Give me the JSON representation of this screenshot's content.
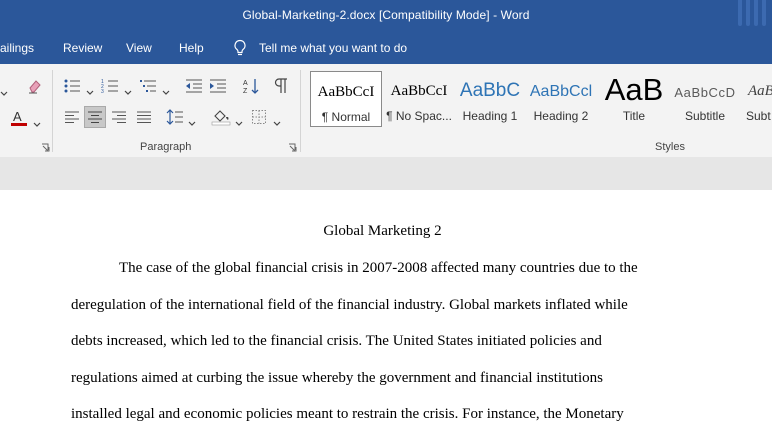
{
  "window": {
    "title": "Global-Marketing-2.docx [Compatibility Mode]  -  Word"
  },
  "tabs": [
    {
      "label": "ailings"
    },
    {
      "label": "Review"
    },
    {
      "label": "View"
    },
    {
      "label": "Help"
    }
  ],
  "tell_me": {
    "label": "Tell me what you want to do",
    "icon": "lightbulb-icon"
  },
  "ribbon": {
    "paragraph_group": {
      "label": "Paragraph"
    },
    "styles_group": {
      "label": "Styles"
    },
    "styles": [
      {
        "sample": "AaBbCcI",
        "name": "¶ Normal",
        "selected": true
      },
      {
        "sample": "AaBbCcI",
        "name": "¶ No Spac..."
      },
      {
        "sample": "AaBbC",
        "name": "Heading 1"
      },
      {
        "sample": "AaBbCcl",
        "name": "Heading 2"
      },
      {
        "sample": "AaB",
        "name": "Title"
      },
      {
        "sample": "AaBbCcD",
        "name": "Subtitle"
      },
      {
        "sample": "AaBl",
        "name": "Subt"
      }
    ],
    "colors": {
      "heading": "#2e74b5",
      "font_color_bar": "#c00000",
      "ribbon_bg": "#f3f3f3",
      "title_bar": "#2b579a"
    }
  },
  "document": {
    "title": "Global Marketing 2",
    "lines": [
      "The case of the global financial crisis in 2007-2008 affected many countries due to the",
      "deregulation of the international field of the financial industry. Global markets inflated while",
      "debts increased, which led to the financial crisis. The United States initiated policies and",
      "regulations aimed at curbing the issue whereby the government and financial institutions",
      "installed legal and economic policies meant to restrain the crisis. For instance, the Monetary"
    ]
  }
}
